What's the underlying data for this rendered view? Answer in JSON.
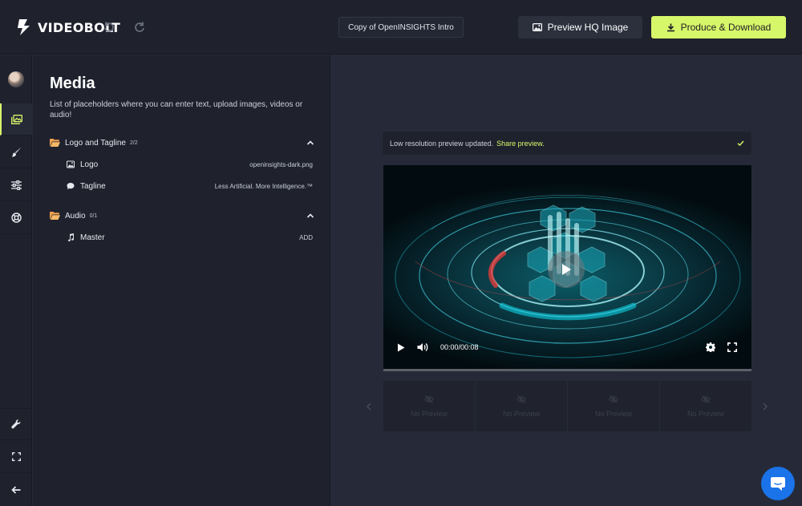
{
  "app": {
    "brand": "VIDEOBOLT",
    "project_name": "Copy of OpenINSIGHTS Intro",
    "preview_hq_label": "Preview HQ Image",
    "produce_label": "Produce & Download"
  },
  "rail": {
    "items": [
      {
        "name": "avatar"
      },
      {
        "name": "media-icon",
        "active": true
      },
      {
        "name": "brush-icon"
      },
      {
        "name": "sliders-icon"
      },
      {
        "name": "lifebuoy-icon"
      },
      {
        "name": "wrench-icon"
      },
      {
        "name": "fullscreen-icon"
      },
      {
        "name": "arrow-left-icon"
      }
    ]
  },
  "media": {
    "title": "Media",
    "description": "List of placeholders where you can enter text, upload images, videos or audio!",
    "groups": [
      {
        "label": "Logo and Tagline",
        "count": "2/2",
        "items": [
          {
            "icon": "image-icon",
            "label": "Logo",
            "value": "openinsights-dark.png"
          },
          {
            "icon": "speech-bubble-icon",
            "label": "Tagline",
            "value": "Less Artificial. More Intelligence.™"
          }
        ]
      },
      {
        "label": "Audio",
        "count": "0/1",
        "items": [
          {
            "icon": "music-note-icon",
            "label": "Master",
            "value": "ADD"
          }
        ]
      }
    ]
  },
  "preview": {
    "notice_text": "Low resolution preview updated.",
    "notice_link": "Share preview.",
    "time": "00:00/00:08",
    "progress": 0,
    "thumbnails": [
      "No Preview",
      "No Preview",
      "No Preview",
      "No Preview"
    ]
  },
  "colors": {
    "accent": "#d7f76a",
    "chat": "#1a73e8"
  }
}
